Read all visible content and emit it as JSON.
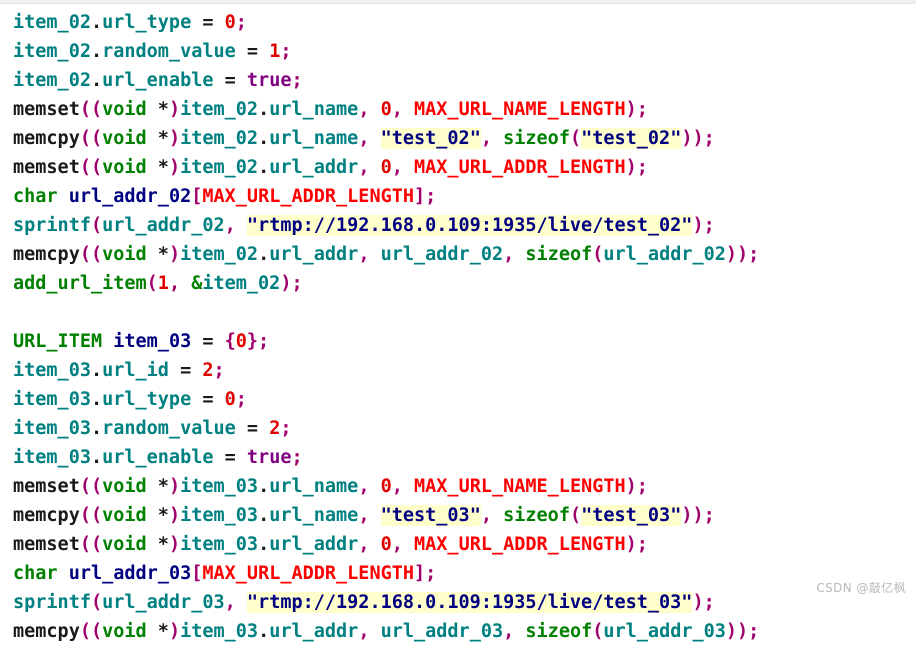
{
  "editor": {
    "language": "c",
    "background": "#ffffff",
    "colors": {
      "variable": "#008080",
      "keyword": "#008000",
      "macro": "#ff0000",
      "number": "#e00000",
      "boolean": "#800080",
      "punctuation": "#a0006c",
      "declaration": "#000080",
      "string": "#000080",
      "string_highlight": "#ffffcc",
      "function": "#1a1a1a"
    }
  },
  "watermark": {
    "text": "CSDN @敲亿枫"
  },
  "code": {
    "lines": [
      {
        "index": 0,
        "text": "item_02.url_type = 0;",
        "tokens": [
          {
            "t": "item_02",
            "c": "t-var"
          },
          {
            "t": ".",
            "c": "t-plain"
          },
          {
            "t": "url_type",
            "c": "t-var"
          },
          {
            "t": " = ",
            "c": "t-plain"
          },
          {
            "t": "0",
            "c": "t-num"
          },
          {
            "t": ";",
            "c": "t-punc"
          }
        ]
      },
      {
        "index": 1,
        "text": "item_02.random_value = 1;",
        "tokens": [
          {
            "t": "item_02",
            "c": "t-var"
          },
          {
            "t": ".",
            "c": "t-plain"
          },
          {
            "t": "random_value",
            "c": "t-var"
          },
          {
            "t": " = ",
            "c": "t-plain"
          },
          {
            "t": "1",
            "c": "t-num"
          },
          {
            "t": ";",
            "c": "t-punc"
          }
        ]
      },
      {
        "index": 2,
        "text": "item_02.url_enable = true;",
        "tokens": [
          {
            "t": "item_02",
            "c": "t-var"
          },
          {
            "t": ".",
            "c": "t-plain"
          },
          {
            "t": "url_enable",
            "c": "t-var"
          },
          {
            "t": " = ",
            "c": "t-plain"
          },
          {
            "t": "true",
            "c": "t-bool"
          },
          {
            "t": ";",
            "c": "t-punc"
          }
        ]
      },
      {
        "index": 3,
        "text": "memset((void *)item_02.url_name, 0, MAX_URL_NAME_LENGTH);",
        "tokens": [
          {
            "t": "memset",
            "c": "t-fn"
          },
          {
            "t": "((",
            "c": "t-punc"
          },
          {
            "t": "void",
            "c": "t-kw"
          },
          {
            "t": " *",
            "c": "t-plain"
          },
          {
            "t": ")",
            "c": "t-punc"
          },
          {
            "t": "item_02",
            "c": "t-var"
          },
          {
            "t": ".",
            "c": "t-plain"
          },
          {
            "t": "url_name",
            "c": "t-var"
          },
          {
            "t": ",",
            "c": "t-punc"
          },
          {
            "t": " ",
            "c": "t-plain"
          },
          {
            "t": "0",
            "c": "t-num"
          },
          {
            "t": ",",
            "c": "t-punc"
          },
          {
            "t": " ",
            "c": "t-plain"
          },
          {
            "t": "MAX_URL_NAME_LENGTH",
            "c": "t-macro"
          },
          {
            "t": ");",
            "c": "t-punc"
          }
        ]
      },
      {
        "index": 4,
        "text": "memcpy((void *)item_02.url_name, \"test_02\", sizeof(\"test_02\"));",
        "tokens": [
          {
            "t": "memcpy",
            "c": "t-fn"
          },
          {
            "t": "((",
            "c": "t-punc"
          },
          {
            "t": "void",
            "c": "t-kw"
          },
          {
            "t": " *",
            "c": "t-plain"
          },
          {
            "t": ")",
            "c": "t-punc"
          },
          {
            "t": "item_02",
            "c": "t-var"
          },
          {
            "t": ".",
            "c": "t-plain"
          },
          {
            "t": "url_name",
            "c": "t-var"
          },
          {
            "t": ",",
            "c": "t-punc"
          },
          {
            "t": " ",
            "c": "t-plain"
          },
          {
            "t": "\"test_02\"",
            "c": "t-str"
          },
          {
            "t": ",",
            "c": "t-punc"
          },
          {
            "t": " ",
            "c": "t-plain"
          },
          {
            "t": "sizeof",
            "c": "t-kw"
          },
          {
            "t": "(",
            "c": "t-punc"
          },
          {
            "t": "\"test_02\"",
            "c": "t-str"
          },
          {
            "t": "));",
            "c": "t-punc"
          }
        ]
      },
      {
        "index": 5,
        "text": "memset((void *)item_02.url_addr, 0, MAX_URL_ADDR_LENGTH);",
        "tokens": [
          {
            "t": "memset",
            "c": "t-fn"
          },
          {
            "t": "((",
            "c": "t-punc"
          },
          {
            "t": "void",
            "c": "t-kw"
          },
          {
            "t": " *",
            "c": "t-plain"
          },
          {
            "t": ")",
            "c": "t-punc"
          },
          {
            "t": "item_02",
            "c": "t-var"
          },
          {
            "t": ".",
            "c": "t-plain"
          },
          {
            "t": "url_addr",
            "c": "t-var"
          },
          {
            "t": ",",
            "c": "t-punc"
          },
          {
            "t": " ",
            "c": "t-plain"
          },
          {
            "t": "0",
            "c": "t-num"
          },
          {
            "t": ",",
            "c": "t-punc"
          },
          {
            "t": " ",
            "c": "t-plain"
          },
          {
            "t": "MAX_URL_ADDR_LENGTH",
            "c": "t-macro"
          },
          {
            "t": ");",
            "c": "t-punc"
          }
        ]
      },
      {
        "index": 6,
        "text": "char url_addr_02[MAX_URL_ADDR_LENGTH];",
        "tokens": [
          {
            "t": "char",
            "c": "t-kw"
          },
          {
            "t": " ",
            "c": "t-plain"
          },
          {
            "t": "url_addr_02",
            "c": "t-decl"
          },
          {
            "t": "[",
            "c": "t-punc"
          },
          {
            "t": "MAX_URL_ADDR_LENGTH",
            "c": "t-macro"
          },
          {
            "t": "];",
            "c": "t-punc"
          }
        ]
      },
      {
        "index": 7,
        "text": "sprintf(url_addr_02, \"rtmp://192.168.0.109:1935/live/test_02\");",
        "tokens": [
          {
            "t": "sprintf",
            "c": "t-var"
          },
          {
            "t": "(",
            "c": "t-punc"
          },
          {
            "t": "url_addr_02",
            "c": "t-var"
          },
          {
            "t": ",",
            "c": "t-punc"
          },
          {
            "t": " ",
            "c": "t-plain"
          },
          {
            "t": "\"rtmp://192.168.0.109:1935/live/test_02\"",
            "c": "t-str"
          },
          {
            "t": ");",
            "c": "t-punc"
          }
        ]
      },
      {
        "index": 8,
        "text": "memcpy((void *)item_02.url_addr, url_addr_02, sizeof(url_addr_02));",
        "tokens": [
          {
            "t": "memcpy",
            "c": "t-fn"
          },
          {
            "t": "((",
            "c": "t-punc"
          },
          {
            "t": "void",
            "c": "t-kw"
          },
          {
            "t": " *",
            "c": "t-plain"
          },
          {
            "t": ")",
            "c": "t-punc"
          },
          {
            "t": "item_02",
            "c": "t-var"
          },
          {
            "t": ".",
            "c": "t-plain"
          },
          {
            "t": "url_addr",
            "c": "t-var"
          },
          {
            "t": ",",
            "c": "t-punc"
          },
          {
            "t": " ",
            "c": "t-plain"
          },
          {
            "t": "url_addr_02",
            "c": "t-var"
          },
          {
            "t": ",",
            "c": "t-punc"
          },
          {
            "t": " ",
            "c": "t-plain"
          },
          {
            "t": "sizeof",
            "c": "t-kw"
          },
          {
            "t": "(",
            "c": "t-punc"
          },
          {
            "t": "url_addr_02",
            "c": "t-var"
          },
          {
            "t": "));",
            "c": "t-punc"
          }
        ]
      },
      {
        "index": 9,
        "text": "add_url_item(1, &item_02);",
        "tokens": [
          {
            "t": "add_url_item",
            "c": "t-fn-user"
          },
          {
            "t": "(",
            "c": "t-punc"
          },
          {
            "t": "1",
            "c": "t-num"
          },
          {
            "t": ",",
            "c": "t-punc"
          },
          {
            "t": " ",
            "c": "t-plain"
          },
          {
            "t": "&",
            "c": "t-kw"
          },
          {
            "t": "item_02",
            "c": "t-var"
          },
          {
            "t": ");",
            "c": "t-punc"
          }
        ]
      },
      {
        "index": 10,
        "text": "",
        "tokens": []
      },
      {
        "index": 11,
        "text": "URL_ITEM item_03 = {0};",
        "tokens": [
          {
            "t": "URL_ITEM",
            "c": "t-type"
          },
          {
            "t": " ",
            "c": "t-plain"
          },
          {
            "t": "item_03",
            "c": "t-decl"
          },
          {
            "t": " = ",
            "c": "t-plain"
          },
          {
            "t": "{",
            "c": "t-punc"
          },
          {
            "t": "0",
            "c": "t-num"
          },
          {
            "t": "};",
            "c": "t-punc"
          }
        ]
      },
      {
        "index": 12,
        "text": "item_03.url_id = 2;",
        "tokens": [
          {
            "t": "item_03",
            "c": "t-var"
          },
          {
            "t": ".",
            "c": "t-plain"
          },
          {
            "t": "url_id",
            "c": "t-var"
          },
          {
            "t": " = ",
            "c": "t-plain"
          },
          {
            "t": "2",
            "c": "t-num"
          },
          {
            "t": ";",
            "c": "t-punc"
          }
        ]
      },
      {
        "index": 13,
        "text": "item_03.url_type = 0;",
        "tokens": [
          {
            "t": "item_03",
            "c": "t-var"
          },
          {
            "t": ".",
            "c": "t-plain"
          },
          {
            "t": "url_type",
            "c": "t-var"
          },
          {
            "t": " = ",
            "c": "t-plain"
          },
          {
            "t": "0",
            "c": "t-num"
          },
          {
            "t": ";",
            "c": "t-punc"
          }
        ]
      },
      {
        "index": 14,
        "text": "item_03.random_value = 2;",
        "tokens": [
          {
            "t": "item_03",
            "c": "t-var"
          },
          {
            "t": ".",
            "c": "t-plain"
          },
          {
            "t": "random_value",
            "c": "t-var"
          },
          {
            "t": " = ",
            "c": "t-plain"
          },
          {
            "t": "2",
            "c": "t-num"
          },
          {
            "t": ";",
            "c": "t-punc"
          }
        ]
      },
      {
        "index": 15,
        "text": "item_03.url_enable = true;",
        "tokens": [
          {
            "t": "item_03",
            "c": "t-var"
          },
          {
            "t": ".",
            "c": "t-plain"
          },
          {
            "t": "url_enable",
            "c": "t-var"
          },
          {
            "t": " = ",
            "c": "t-plain"
          },
          {
            "t": "true",
            "c": "t-bool"
          },
          {
            "t": ";",
            "c": "t-punc"
          }
        ]
      },
      {
        "index": 16,
        "text": "memset((void *)item_03.url_name, 0, MAX_URL_NAME_LENGTH);",
        "tokens": [
          {
            "t": "memset",
            "c": "t-fn"
          },
          {
            "t": "((",
            "c": "t-punc"
          },
          {
            "t": "void",
            "c": "t-kw"
          },
          {
            "t": " *",
            "c": "t-plain"
          },
          {
            "t": ")",
            "c": "t-punc"
          },
          {
            "t": "item_03",
            "c": "t-var"
          },
          {
            "t": ".",
            "c": "t-plain"
          },
          {
            "t": "url_name",
            "c": "t-var"
          },
          {
            "t": ",",
            "c": "t-punc"
          },
          {
            "t": " ",
            "c": "t-plain"
          },
          {
            "t": "0",
            "c": "t-num"
          },
          {
            "t": ",",
            "c": "t-punc"
          },
          {
            "t": " ",
            "c": "t-plain"
          },
          {
            "t": "MAX_URL_NAME_LENGTH",
            "c": "t-macro"
          },
          {
            "t": ");",
            "c": "t-punc"
          }
        ]
      },
      {
        "index": 17,
        "text": "memcpy((void *)item_03.url_name, \"test_03\", sizeof(\"test_03\"));",
        "tokens": [
          {
            "t": "memcpy",
            "c": "t-fn"
          },
          {
            "t": "((",
            "c": "t-punc"
          },
          {
            "t": "void",
            "c": "t-kw"
          },
          {
            "t": " *",
            "c": "t-plain"
          },
          {
            "t": ")",
            "c": "t-punc"
          },
          {
            "t": "item_03",
            "c": "t-var"
          },
          {
            "t": ".",
            "c": "t-plain"
          },
          {
            "t": "url_name",
            "c": "t-var"
          },
          {
            "t": ",",
            "c": "t-punc"
          },
          {
            "t": " ",
            "c": "t-plain"
          },
          {
            "t": "\"test_03\"",
            "c": "t-str"
          },
          {
            "t": ",",
            "c": "t-punc"
          },
          {
            "t": " ",
            "c": "t-plain"
          },
          {
            "t": "sizeof",
            "c": "t-kw"
          },
          {
            "t": "(",
            "c": "t-punc"
          },
          {
            "t": "\"test_03\"",
            "c": "t-str"
          },
          {
            "t": "));",
            "c": "t-punc"
          }
        ]
      },
      {
        "index": 18,
        "text": "memset((void *)item_03.url_addr, 0, MAX_URL_ADDR_LENGTH);",
        "tokens": [
          {
            "t": "memset",
            "c": "t-fn"
          },
          {
            "t": "((",
            "c": "t-punc"
          },
          {
            "t": "void",
            "c": "t-kw"
          },
          {
            "t": " *",
            "c": "t-plain"
          },
          {
            "t": ")",
            "c": "t-punc"
          },
          {
            "t": "item_03",
            "c": "t-var"
          },
          {
            "t": ".",
            "c": "t-plain"
          },
          {
            "t": "url_addr",
            "c": "t-var"
          },
          {
            "t": ",",
            "c": "t-punc"
          },
          {
            "t": " ",
            "c": "t-plain"
          },
          {
            "t": "0",
            "c": "t-num"
          },
          {
            "t": ",",
            "c": "t-punc"
          },
          {
            "t": " ",
            "c": "t-plain"
          },
          {
            "t": "MAX_URL_ADDR_LENGTH",
            "c": "t-macro"
          },
          {
            "t": ");",
            "c": "t-punc"
          }
        ]
      },
      {
        "index": 19,
        "text": "char url_addr_03[MAX_URL_ADDR_LENGTH];",
        "tokens": [
          {
            "t": "char",
            "c": "t-kw"
          },
          {
            "t": " ",
            "c": "t-plain"
          },
          {
            "t": "url_addr_03",
            "c": "t-decl"
          },
          {
            "t": "[",
            "c": "t-punc"
          },
          {
            "t": "MAX_URL_ADDR_LENGTH",
            "c": "t-macro"
          },
          {
            "t": "];",
            "c": "t-punc"
          }
        ]
      },
      {
        "index": 20,
        "text": "sprintf(url_addr_03, \"rtmp://192.168.0.109:1935/live/test_03\");",
        "tokens": [
          {
            "t": "sprintf",
            "c": "t-var"
          },
          {
            "t": "(",
            "c": "t-punc"
          },
          {
            "t": "url_addr_03",
            "c": "t-var"
          },
          {
            "t": ",",
            "c": "t-punc"
          },
          {
            "t": " ",
            "c": "t-plain"
          },
          {
            "t": "\"rtmp://192.168.0.109:1935/live/test_03\"",
            "c": "t-str"
          },
          {
            "t": ");",
            "c": "t-punc"
          }
        ]
      },
      {
        "index": 21,
        "text": "memcpy((void *)item_03.url_addr, url_addr_03, sizeof(url_addr_03));",
        "tokens": [
          {
            "t": "memcpy",
            "c": "t-fn"
          },
          {
            "t": "((",
            "c": "t-punc"
          },
          {
            "t": "void",
            "c": "t-kw"
          },
          {
            "t": " *",
            "c": "t-plain"
          },
          {
            "t": ")",
            "c": "t-punc"
          },
          {
            "t": "item_03",
            "c": "t-var"
          },
          {
            "t": ".",
            "c": "t-plain"
          },
          {
            "t": "url_addr",
            "c": "t-var"
          },
          {
            "t": ",",
            "c": "t-punc"
          },
          {
            "t": " ",
            "c": "t-plain"
          },
          {
            "t": "url_addr_03",
            "c": "t-var"
          },
          {
            "t": ",",
            "c": "t-punc"
          },
          {
            "t": " ",
            "c": "t-plain"
          },
          {
            "t": "sizeof",
            "c": "t-kw"
          },
          {
            "t": "(",
            "c": "t-punc"
          },
          {
            "t": "url_addr_03",
            "c": "t-var"
          },
          {
            "t": "));",
            "c": "t-punc"
          }
        ]
      }
    ]
  }
}
